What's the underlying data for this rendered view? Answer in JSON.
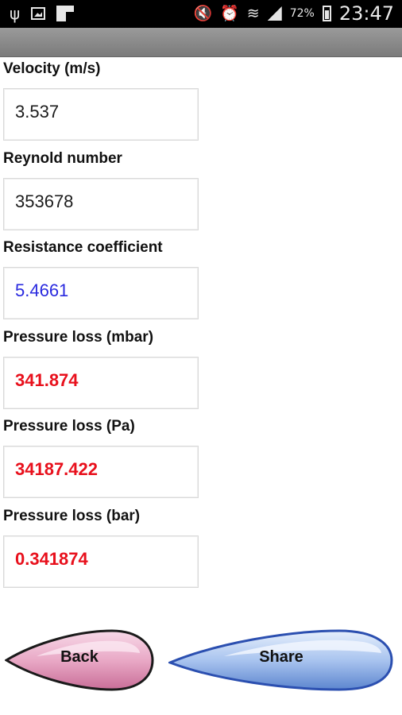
{
  "status_bar": {
    "icons": [
      "usb-icon",
      "image-icon",
      "flipboard-icon",
      "mute-icon",
      "alarm-icon",
      "wifi-icon",
      "signal-icon",
      "battery-icon"
    ],
    "battery": "72%",
    "time": "23:47"
  },
  "fields": [
    {
      "label": "Velocity (m/s)",
      "value": "3.537",
      "color": "#1c1c1c"
    },
    {
      "label": "Reynold number",
      "value": "353678",
      "color": "#1c1c1c"
    },
    {
      "label": "Resistance coefficient",
      "value": "5.4661",
      "color": "#2a2adf"
    },
    {
      "label": "Pressure loss (mbar)",
      "value": "341.874",
      "color": "#e8101c"
    },
    {
      "label": "Pressure loss (Pa)",
      "value": "34187.422",
      "color": "#e8101c"
    },
    {
      "label": "Pressure loss (bar)",
      "value": "0.341874",
      "color": "#e8101c"
    }
  ],
  "buttons": {
    "back": "Back",
    "share": "Share"
  },
  "colors": {
    "back_button": "#e9a9c6",
    "share_button": "#a9c4ef"
  }
}
